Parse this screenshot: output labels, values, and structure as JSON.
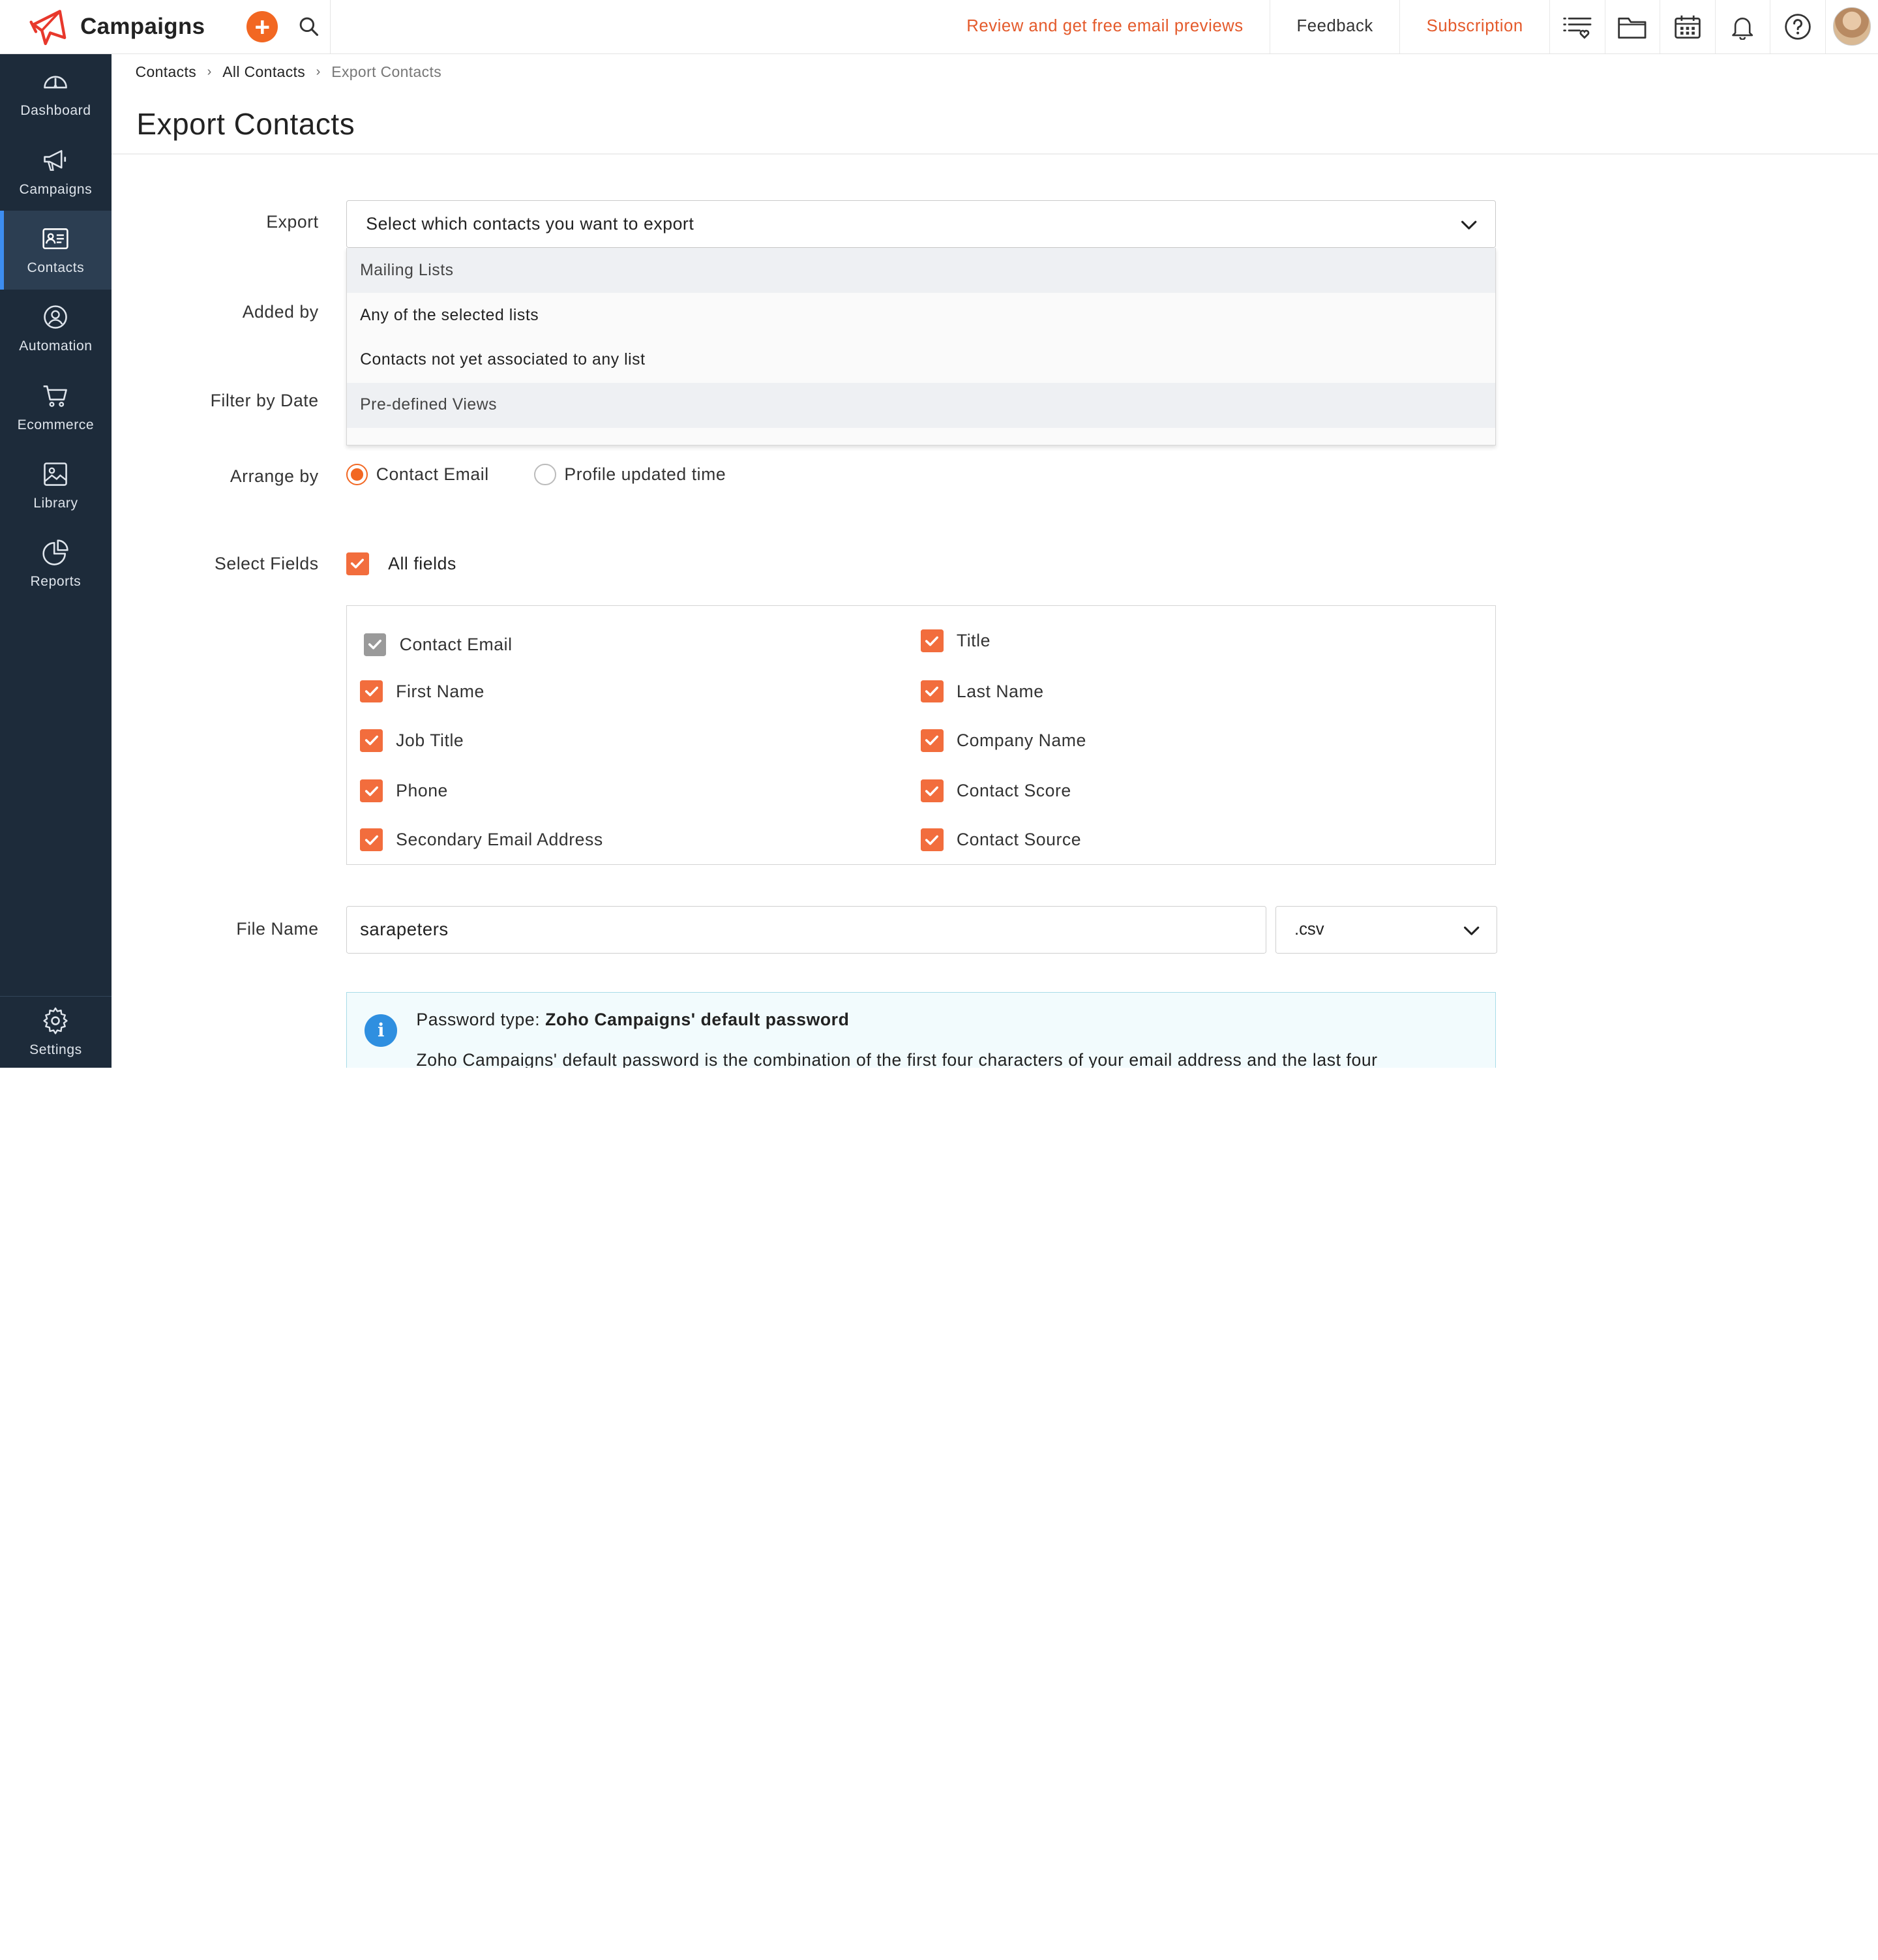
{
  "header": {
    "brand": "Campaigns",
    "links": {
      "review": "Review and get free email previews",
      "feedback": "Feedback",
      "subscription": "Subscription"
    },
    "accent": "#f26722"
  },
  "sidebar": {
    "items": [
      {
        "label": "Dashboard",
        "icon": "speedometer-icon"
      },
      {
        "label": "Campaigns",
        "icon": "megaphone-icon"
      },
      {
        "label": "Contacts",
        "icon": "contact-card-icon",
        "active": true
      },
      {
        "label": "Automation",
        "icon": "automation-icon"
      },
      {
        "label": "Ecommerce",
        "icon": "cart-icon"
      },
      {
        "label": "Library",
        "icon": "image-library-icon"
      },
      {
        "label": "Reports",
        "icon": "pie-chart-icon"
      }
    ],
    "settings": "Settings",
    "bg": "#1d2b3a",
    "active_indicator": "#3d8df0"
  },
  "breadcrumb": [
    "Contacts",
    "All Contacts",
    "Export Contacts"
  ],
  "page_title": "Export Contacts",
  "form": {
    "labels": {
      "export": "Export",
      "added_by": "Added by",
      "filter_by_date": "Filter by Date",
      "arrange_by": "Arrange by",
      "select_fields": "Select Fields",
      "file_name": "File Name"
    },
    "export_select": {
      "value": "Select which contacts you want to export",
      "options": [
        {
          "label": "Mailing Lists",
          "group": true
        },
        {
          "label": "Any of the selected lists",
          "group": false
        },
        {
          "label": "Contacts not yet associated to any list",
          "group": false
        },
        {
          "label": "Pre-defined Views",
          "group": true
        }
      ]
    },
    "arrange_by": {
      "options": [
        "Contact Email",
        "Profile updated time"
      ],
      "selected": "Contact Email"
    },
    "all_fields": {
      "label": "All fields",
      "checked": true
    },
    "fields": [
      {
        "label": "Contact Email",
        "checked": true,
        "locked": true
      },
      {
        "label": "Title",
        "checked": true
      },
      {
        "label": "First Name",
        "checked": true
      },
      {
        "label": "Last Name",
        "checked": true
      },
      {
        "label": "Job Title",
        "checked": true
      },
      {
        "label": "Company Name",
        "checked": true
      },
      {
        "label": "Phone",
        "checked": true
      },
      {
        "label": "Contact Score",
        "checked": true
      },
      {
        "label": "Secondary Email Address",
        "checked": true
      },
      {
        "label": "Contact Source",
        "checked": true
      }
    ],
    "file_name": "sarapeters",
    "extension": ".csv"
  },
  "info": {
    "title_prefix": "Password type:",
    "title_value": "Zoho Campaigns' default password",
    "text": "Zoho Campaigns' default password is the combination of the first four characters of your email address and the last four"
  }
}
